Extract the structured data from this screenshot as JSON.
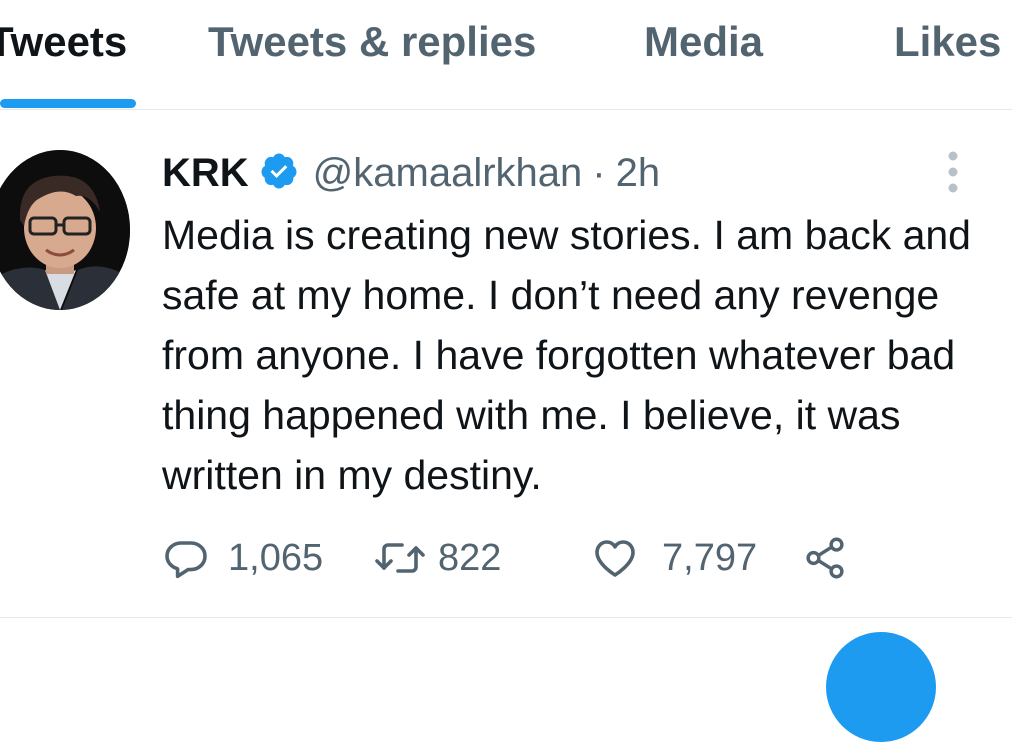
{
  "tabs": [
    {
      "label": "Tweets",
      "active": true
    },
    {
      "label": "Tweets & replies",
      "active": false
    },
    {
      "label": "Media",
      "active": false
    },
    {
      "label": "Likes",
      "active": false
    }
  ],
  "tweet": {
    "author_name": "KRK",
    "verified": true,
    "handle": "@kamaalrkhan",
    "separator": "·",
    "time": "2h",
    "text": "Media is creating new stories. I am back and safe at my home. I don’t need any revenge from anyone. I have forgotten whatever bad thing happened with me. I believe, it was written in my destiny.",
    "actions": {
      "reply_count": "1,065",
      "retweet_count": "822",
      "like_count": "7,797"
    },
    "icons": [
      "reply-icon",
      "retweet-icon",
      "like-icon",
      "share-icon",
      "more-icon",
      "verified-badge-icon"
    ]
  },
  "colors": {
    "accent": "#1d9bf0",
    "text_primary": "#0f1419",
    "text_secondary": "#536471",
    "divider": "#e6e9ec"
  }
}
